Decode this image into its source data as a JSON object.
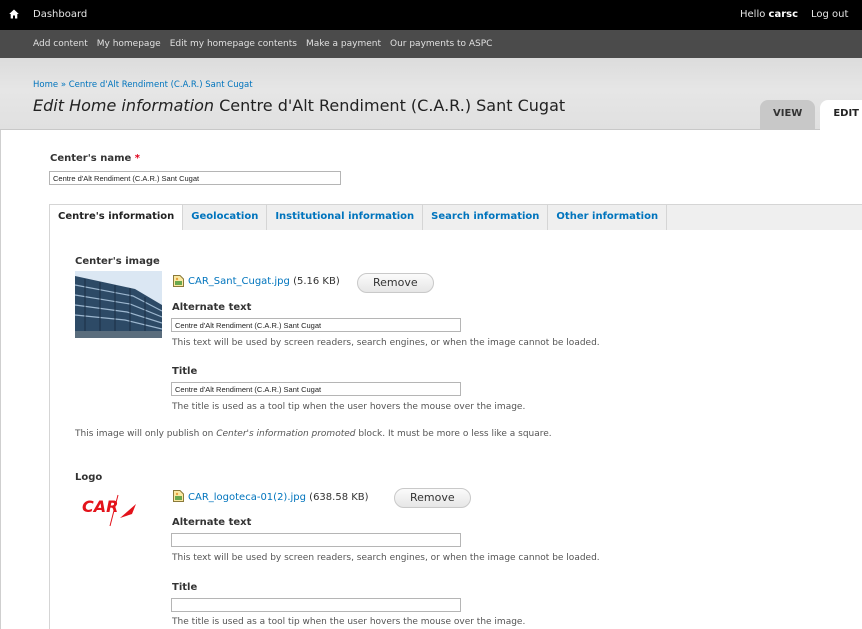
{
  "toolbar": {
    "dashboard_label": "Dashboard",
    "greeting": "Hello",
    "username": "carsc",
    "logout_label": "Log out"
  },
  "shortcuts": [
    "Add content",
    "My homepage",
    "Edit my homepage contents",
    "Make a payment",
    "Our payments to ASPC"
  ],
  "breadcrumb": {
    "home": "Home",
    "separator": "»",
    "current": "Centre d'Alt Rendiment (C.A.R.) Sant Cugat"
  },
  "page_title": {
    "prefix": "Edit Home information",
    "node": "Centre d'Alt Rendiment (C.A.R.) Sant Cugat"
  },
  "primary_tabs": [
    "VIEW",
    "EDIT"
  ],
  "center_name": {
    "label": "Center's name",
    "required_marker": "*",
    "value": "Centre d'Alt Rendiment (C.A.R.) Sant Cugat"
  },
  "form_tabs": [
    "Centre's information",
    "Geolocation",
    "Institutional information",
    "Search information",
    "Other information"
  ],
  "center_image": {
    "label": "Center's image",
    "file_name": "CAR_Sant_Cugat.jpg",
    "file_size": "(5.16 KB)",
    "remove_label": "Remove",
    "alt_label": "Alternate text",
    "alt_value": "Centre d'Alt Rendiment (C.A.R.) Sant Cugat",
    "alt_desc": "This text will be used by screen readers, search engines, or when the image cannot be loaded.",
    "title_label": "Title",
    "title_value": "Centre d'Alt Rendiment (C.A.R.) Sant Cugat",
    "title_desc": "The title is used as a tool tip when the user hovers the mouse over the image.",
    "note_before": "This image will only publish on ",
    "note_emph": "Center's information promoted",
    "note_after": " block. It must be more o less like a square."
  },
  "logo": {
    "label": "Logo",
    "image_text": "CAR",
    "file_name": "CAR_logoteca-01(2).jpg",
    "file_size": "(638.58 KB)",
    "remove_label": "Remove",
    "alt_label": "Alternate text",
    "alt_value": "",
    "alt_desc": "This text will be used by screen readers, search engines, or when the image cannot be loaded.",
    "title_label": "Title",
    "title_value": "",
    "title_desc": "The title is used as a tool tip when the user hovers the mouse over the image."
  },
  "colors": {
    "link": "#0074bd",
    "toolbar_bg": "#000000",
    "shortcut_bg": "#4b4b4b",
    "required": "#e0001b",
    "logo_red": "#e3131b"
  }
}
